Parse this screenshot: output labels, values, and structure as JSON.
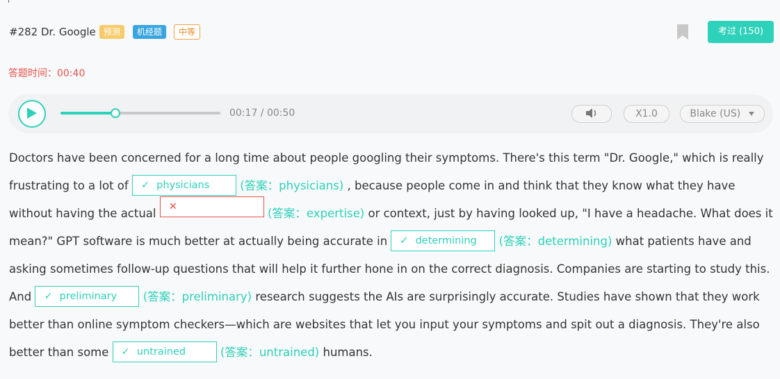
{
  "header": {
    "title": "#282 Dr. Google",
    "tags": [
      "预测",
      "机经题",
      "中等"
    ],
    "exam_button": "考过 (150)"
  },
  "timer": {
    "label": "答题时间：",
    "value": "00:40"
  },
  "player": {
    "current": "00:17",
    "total": "00:50",
    "time_display": "00:17 / 00:50",
    "progress": 0.34,
    "speed": "X1.0",
    "voice": "Blake (US)"
  },
  "colors": {
    "accent": "#2ed1b9",
    "error": "#e5534b"
  },
  "passage": {
    "t1": "Doctors have been concerned for a long time about people googling their symptoms. There's this term \"Dr. Google,\" which is really frustrating to a lot of",
    "b1": "physicians",
    "a1": "(答案：physicians)",
    "t2": ", because people come in and think that they know what they have without having the actual",
    "b2": "",
    "a2": "(答案：expertise)",
    "t3": "or context, just by having looked up, \"I have a headache. What does it mean?\" GPT software is much better at actually being accurate in",
    "b3": "determining",
    "a3": "(答案：determining)",
    "t4": "what patients have and asking sometimes follow-up questions that will help it further hone in on the correct diagnosis. Companies are starting to study this. And",
    "b4": "preliminary",
    "a4": "(答案：preliminary)",
    "t5": "research suggests the AIs are surprisingly accurate. Studies have shown that they work better than online symptom checkers—which are websites that let you input your symptoms and spit out a diagnosis. They're also better than some",
    "b5": "untrained",
    "a5": "(答案：untrained)",
    "t6": "humans."
  }
}
